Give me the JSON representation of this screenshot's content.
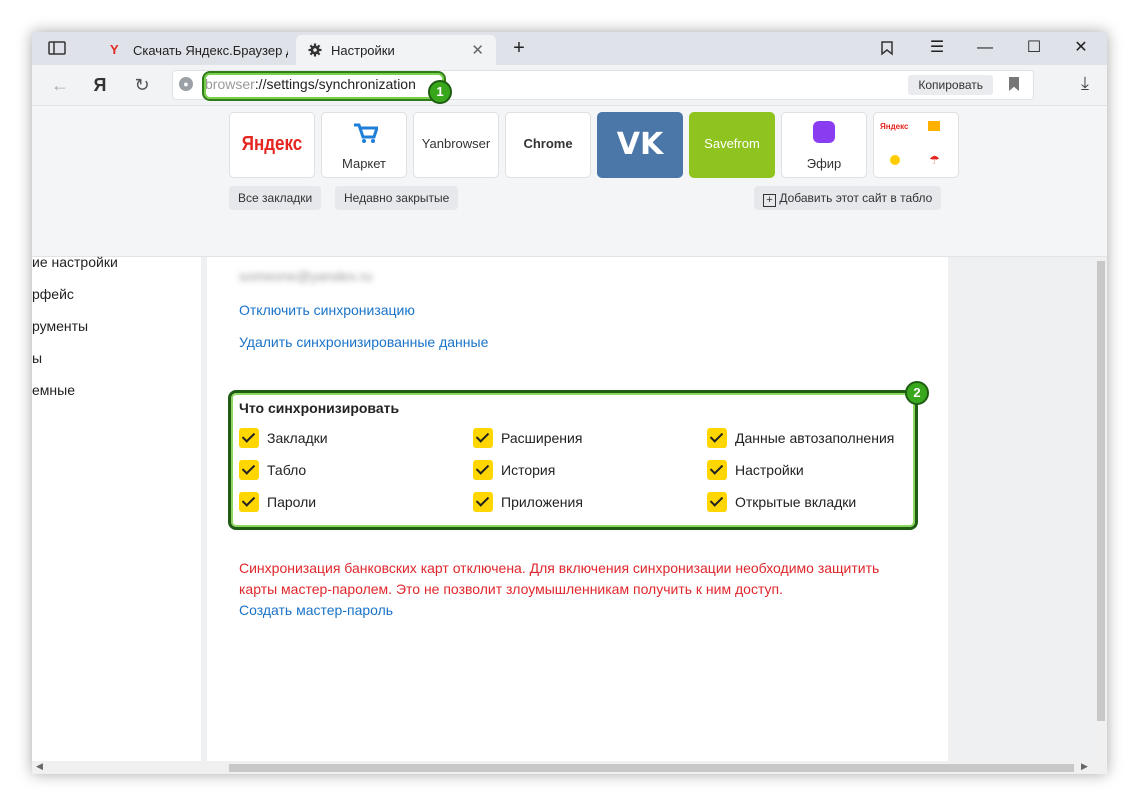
{
  "tabs": [
    {
      "label": "Скачать Яндекс.Браузер д",
      "icon": "yandex-icon"
    },
    {
      "label": "Настройки",
      "icon": "gear-icon",
      "active": true
    }
  ],
  "address": {
    "scheme": "browser",
    "path": "://settings/synchronization",
    "copy_label": "Копировать"
  },
  "markers": {
    "one": "1",
    "two": "2"
  },
  "tableau": {
    "tiles": [
      {
        "name": "Яндекс"
      },
      {
        "name": "Маркет"
      },
      {
        "name": "Yanbrowser"
      },
      {
        "name": "Chrome"
      },
      {
        "name": "VK"
      },
      {
        "name": "Savefrom"
      },
      {
        "name": "Эфир"
      },
      {
        "name": "Яндекс"
      }
    ],
    "all_bookmarks": "Все закладки",
    "recently_closed": "Недавно закрытые",
    "add_site": "Добавить этот сайт в табло"
  },
  "sidebar": [
    "ие настройки",
    "рфейс",
    "рументы",
    "ы",
    "емные"
  ],
  "sync": {
    "email": "someone@yandex.ru",
    "disable": "Отключить синхронизацию",
    "delete": "Удалить синхронизированные данные",
    "title": "Что синхронизировать",
    "items": [
      "Закладки",
      "Расширения",
      "Данные автозаполнения",
      "Табло",
      "История",
      "Настройки",
      "Пароли",
      "Приложения",
      "Открытые вкладки"
    ],
    "warning": "Синхронизация банковских карт отключена. Для включения синхронизации необходимо защитить карты мастер-паролем. Это не позволит злоумышленникам получить к ним доступ.",
    "create_password": "Создать мастер-пароль"
  },
  "colors": {
    "accent_link": "#1a73c9",
    "warning": "#e0272c",
    "checkbox": "#ffd600",
    "marker": "#39a71c"
  }
}
